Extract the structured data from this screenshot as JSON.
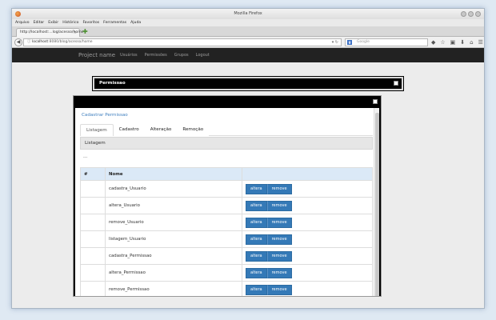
{
  "window": {
    "title": "Mozilla Firefox"
  },
  "menu": [
    "Arquivo",
    "Editar",
    "Exibir",
    "Histórico",
    "Favoritos",
    "Ferramentas",
    "Ajuda"
  ],
  "tab": {
    "label": "http://localhost:...log/acesso/home"
  },
  "address": {
    "host": "localhost",
    "path": ":8080/blog/acesso/home"
  },
  "search": {
    "placeholder": "Google"
  },
  "navbar": {
    "brand": "Project name",
    "links": [
      "Usuários",
      "Permissões",
      "Grupos",
      "Logout"
    ]
  },
  "permissao_window": {
    "title": "Permissao"
  },
  "dialog": {
    "title": "Cadastrar Permissao",
    "tabs": [
      "Listagem",
      "Cadastro",
      "Alteração",
      "Remoção"
    ],
    "active_tab": "Listagem",
    "panel_heading": "Listagem",
    "placeholder": "...",
    "table": {
      "headers": [
        "#",
        "Nome",
        ""
      ],
      "rows": [
        {
          "id": "",
          "name": "cadastra_Usuario"
        },
        {
          "id": "",
          "name": "altera_Usuario"
        },
        {
          "id": "",
          "name": "remove_Usuario"
        },
        {
          "id": "",
          "name": "listagem_Usuario"
        },
        {
          "id": "",
          "name": "cadastra_Permissao"
        },
        {
          "id": "",
          "name": "altera_Permissao"
        },
        {
          "id": "",
          "name": "remove_Permissao"
        }
      ],
      "edit_label": "altera",
      "remove_label": "remove"
    }
  },
  "colors": {
    "accent": "#3479b7",
    "navbar": "#222222",
    "title_link": "#3f7fbf"
  }
}
